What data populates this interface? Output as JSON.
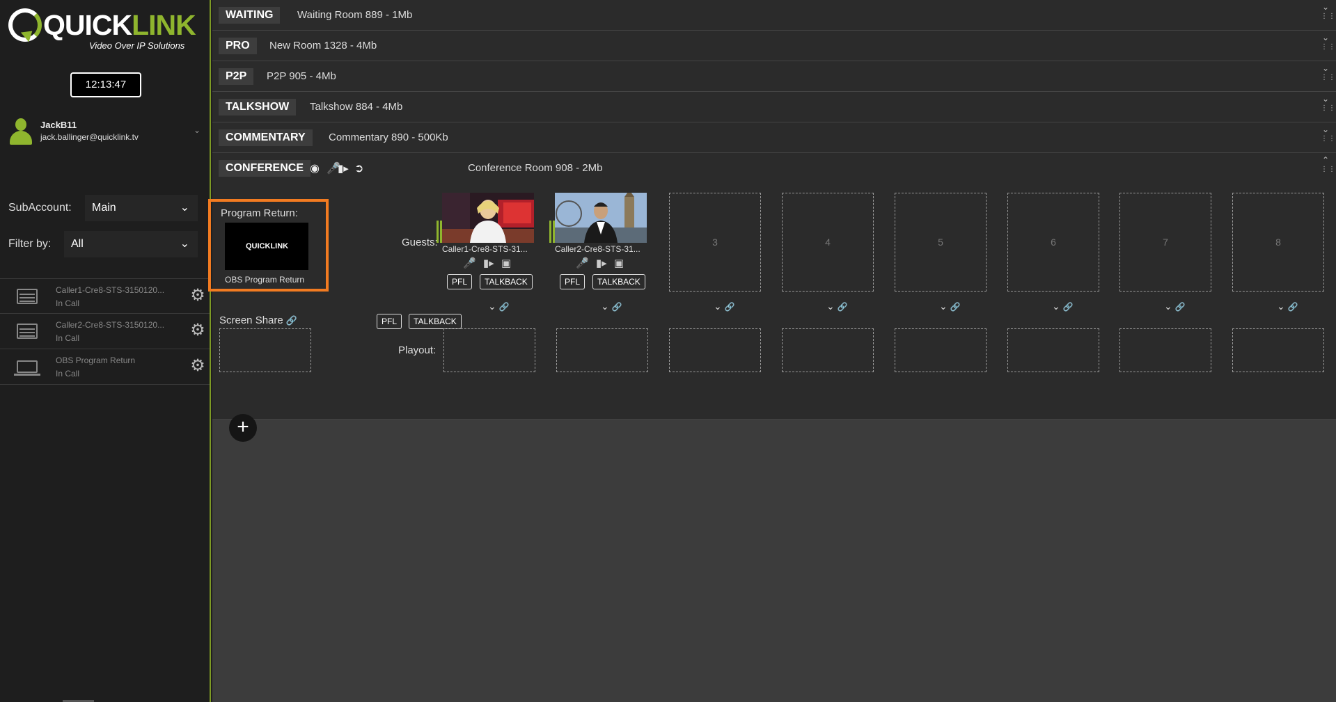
{
  "brand": {
    "name_prefix": "QUICK",
    "name_suffix": "LINK",
    "tagline": "Video Over IP Solutions",
    "accent": "#8fb52e",
    "highlight": "#f27b21"
  },
  "clock": "12:13:47",
  "user": {
    "name": "JackB11",
    "email": "jack.ballinger@quicklink.tv"
  },
  "filters": {
    "subaccount_label": "SubAccount:",
    "subaccount_value": "Main",
    "filter_label": "Filter by:",
    "filter_value": "All"
  },
  "calls": [
    {
      "name": "Caller1-Cre8-STS-3150120...",
      "status": "In Call",
      "icon": "rack-icon"
    },
    {
      "name": "Caller2-Cre8-STS-3150120...",
      "status": "In Call",
      "icon": "rack-icon"
    },
    {
      "name": "OBS Program Return",
      "status": "In Call",
      "icon": "laptop-icon"
    }
  ],
  "rooms": [
    {
      "tag": "WAITING",
      "desc": "Waiting Room 889 - 1Mb"
    },
    {
      "tag": "PRO",
      "desc": "New Room 1328 - 4Mb"
    },
    {
      "tag": "P2P",
      "desc": "P2P 905 - 4Mb"
    },
    {
      "tag": "TALKSHOW",
      "desc": "Talkshow 884 - 4Mb"
    },
    {
      "tag": "COMMENTARY",
      "desc": "Commentary 890 - 500Kb"
    }
  ],
  "conference": {
    "tag": "CONFERENCE",
    "pfl_label": "PFL",
    "talkback_label": "TALKBACK",
    "desc": "Conference Room 908 - 2Mb",
    "program_return_label": "Program Return:",
    "program_return_caption": "OBS Program Return",
    "program_return_logo": "QUICKLINK",
    "guests_label": "Guests:",
    "playout_label": "Playout:",
    "screen_share_label": "Screen Share",
    "guests": [
      {
        "caption": "Caller1-Cre8-STS-31...",
        "pfl": "PFL",
        "talkback": "TALKBACK"
      },
      {
        "caption": "Caller2-Cre8-STS-31...",
        "pfl": "PFL",
        "talkback": "TALKBACK"
      }
    ],
    "empty_slots": [
      "3",
      "4",
      "5",
      "6",
      "7",
      "8"
    ]
  }
}
